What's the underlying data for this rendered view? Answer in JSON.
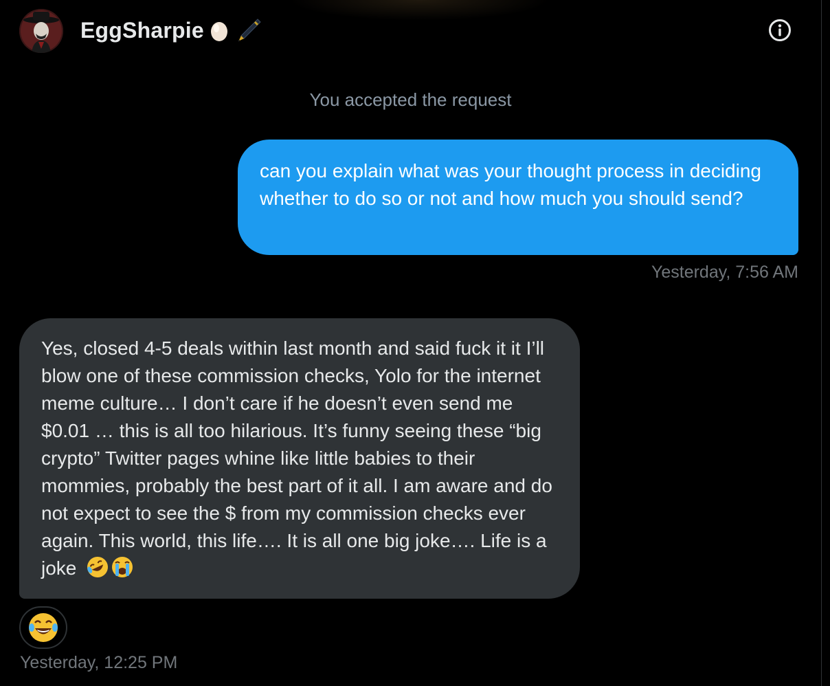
{
  "header": {
    "display_name": "EggSharpie",
    "name_emojis": [
      "egg-emoji",
      "pen-emoji"
    ],
    "info_icon": "info-circle-icon"
  },
  "conversation": {
    "system_message": "You accepted the request",
    "messages": [
      {
        "direction": "outgoing",
        "text": "can you explain what was your thought process in deciding whether to do so or not and how much you should send?",
        "timestamp": "Yesterday, 7:56 AM"
      },
      {
        "direction": "incoming",
        "text": "Yes, closed 4-5 deals within last month and said fuck it it I’ll blow one of these commission checks, Yolo for the internet meme culture… I don’t care if he doesn’t even send me $0.01 … this is all too hilarious. It’s funny seeing these “big crypto” Twitter pages whine like little babies to their mommies, probably the best part of it all. I am aware and do not expect to see the $ from my commission checks ever again. This world, this life…. It is all one big joke…. Life is a joke",
        "trailing_emojis": [
          "rolling-on-floor-laughing-emoji",
          "loudly-crying-face-emoji"
        ],
        "reaction": "tears-of-joy-emoji",
        "timestamp": "Yesterday, 12:25 PM"
      }
    ]
  },
  "colors": {
    "background": "#000000",
    "outgoing_bubble": "#1d9bf0",
    "incoming_bubble": "#2f3336",
    "secondary_text": "#71767b",
    "primary_text": "#e7e9ea"
  }
}
